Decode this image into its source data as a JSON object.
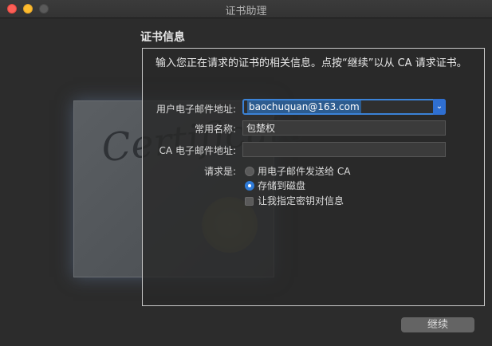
{
  "window": {
    "title": "证书助理"
  },
  "section_title": "证书信息",
  "intro": "输入您正在请求的证书的相关信息。点按“继续”以从 CA 请求证书。",
  "form": {
    "email_label": "用户电子邮件地址:",
    "email_value": "baochuquan@163.com",
    "common_name_label": "常用名称:",
    "common_name_value": "包楚权",
    "ca_email_label": "CA 电子邮件地址:",
    "ca_email_value": "",
    "request_label": "请求是:",
    "options": {
      "email_ca": "用电子邮件发送给 CA",
      "save_disk": "存储到磁盘",
      "specify_key": "让我指定密钥对信息"
    },
    "selected": "save_disk"
  },
  "buttons": {
    "continue": "继续"
  },
  "certificate_watermark": "Certificate"
}
